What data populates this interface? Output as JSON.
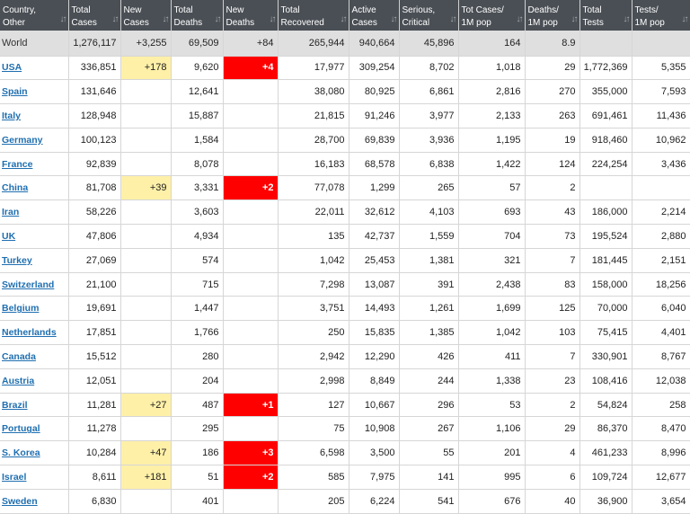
{
  "headers": [
    {
      "line1": "Country,",
      "line2": "Other"
    },
    {
      "line1": "Total",
      "line2": "Cases"
    },
    {
      "line1": "New",
      "line2": "Cases"
    },
    {
      "line1": "Total",
      "line2": "Deaths"
    },
    {
      "line1": "New",
      "line2": "Deaths"
    },
    {
      "line1": "Total",
      "line2": "Recovered"
    },
    {
      "line1": "Active",
      "line2": "Cases"
    },
    {
      "line1": "Serious,",
      "line2": "Critical"
    },
    {
      "line1": "Tot Cases/",
      "line2": "1M pop"
    },
    {
      "line1": "Deaths/",
      "line2": "1M pop"
    },
    {
      "line1": "Total",
      "line2": "Tests"
    },
    {
      "line1": "Tests/",
      "line2": "1M pop"
    }
  ],
  "world": [
    "World",
    "1,276,117",
    "+3,255",
    "69,509",
    "+84",
    "265,944",
    "940,664",
    "45,896",
    "164",
    "8.9",
    "",
    ""
  ],
  "rows": [
    [
      "USA",
      "336,851",
      "+178",
      "9,620",
      "+4",
      "17,977",
      "309,254",
      "8,702",
      "1,018",
      "29",
      "1,772,369",
      "5,355"
    ],
    [
      "Spain",
      "131,646",
      "",
      "12,641",
      "",
      "38,080",
      "80,925",
      "6,861",
      "2,816",
      "270",
      "355,000",
      "7,593"
    ],
    [
      "Italy",
      "128,948",
      "",
      "15,887",
      "",
      "21,815",
      "91,246",
      "3,977",
      "2,133",
      "263",
      "691,461",
      "11,436"
    ],
    [
      "Germany",
      "100,123",
      "",
      "1,584",
      "",
      "28,700",
      "69,839",
      "3,936",
      "1,195",
      "19",
      "918,460",
      "10,962"
    ],
    [
      "France",
      "92,839",
      "",
      "8,078",
      "",
      "16,183",
      "68,578",
      "6,838",
      "1,422",
      "124",
      "224,254",
      "3,436"
    ],
    [
      "China",
      "81,708",
      "+39",
      "3,331",
      "+2",
      "77,078",
      "1,299",
      "265",
      "57",
      "2",
      "",
      ""
    ],
    [
      "Iran",
      "58,226",
      "",
      "3,603",
      "",
      "22,011",
      "32,612",
      "4,103",
      "693",
      "43",
      "186,000",
      "2,214"
    ],
    [
      "UK",
      "47,806",
      "",
      "4,934",
      "",
      "135",
      "42,737",
      "1,559",
      "704",
      "73",
      "195,524",
      "2,880"
    ],
    [
      "Turkey",
      "27,069",
      "",
      "574",
      "",
      "1,042",
      "25,453",
      "1,381",
      "321",
      "7",
      "181,445",
      "2,151"
    ],
    [
      "Switzerland",
      "21,100",
      "",
      "715",
      "",
      "7,298",
      "13,087",
      "391",
      "2,438",
      "83",
      "158,000",
      "18,256"
    ],
    [
      "Belgium",
      "19,691",
      "",
      "1,447",
      "",
      "3,751",
      "14,493",
      "1,261",
      "1,699",
      "125",
      "70,000",
      "6,040"
    ],
    [
      "Netherlands",
      "17,851",
      "",
      "1,766",
      "",
      "250",
      "15,835",
      "1,385",
      "1,042",
      "103",
      "75,415",
      "4,401"
    ],
    [
      "Canada",
      "15,512",
      "",
      "280",
      "",
      "2,942",
      "12,290",
      "426",
      "411",
      "7",
      "330,901",
      "8,767"
    ],
    [
      "Austria",
      "12,051",
      "",
      "204",
      "",
      "2,998",
      "8,849",
      "244",
      "1,338",
      "23",
      "108,416",
      "12,038"
    ],
    [
      "Brazil",
      "11,281",
      "+27",
      "487",
      "+1",
      "127",
      "10,667",
      "296",
      "53",
      "2",
      "54,824",
      "258"
    ],
    [
      "Portugal",
      "11,278",
      "",
      "295",
      "",
      "75",
      "10,908",
      "267",
      "1,106",
      "29",
      "86,370",
      "8,470"
    ],
    [
      "S. Korea",
      "10,284",
      "+47",
      "186",
      "+3",
      "6,598",
      "3,500",
      "55",
      "201",
      "4",
      "461,233",
      "8,996"
    ],
    [
      "Israel",
      "8,611",
      "+181",
      "51",
      "+2",
      "585",
      "7,975",
      "141",
      "995",
      "6",
      "109,724",
      "12,677"
    ],
    [
      "Sweden",
      "6,830",
      "",
      "401",
      "",
      "205",
      "6,224",
      "541",
      "676",
      "40",
      "36,900",
      "3,654"
    ]
  ],
  "colors": {
    "header_bg": "#4a4f55",
    "new_cases_highlight": "#fff0a8",
    "new_deaths_highlight": "#ff0000",
    "country_link": "#1f6fb0",
    "world_row_bg": "#dfdfdf"
  }
}
